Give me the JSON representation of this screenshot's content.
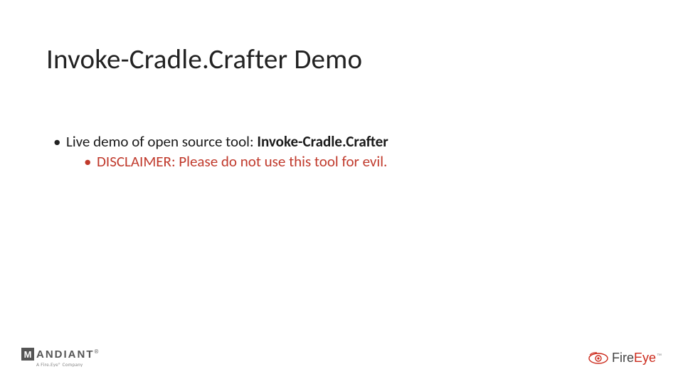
{
  "title": "Invoke-Cradle.Crafter Demo",
  "bullets": {
    "lvl1_prefix": "Live demo of open source tool: ",
    "lvl1_bold": "Invoke-Cradle.Crafter",
    "lvl2": "DISCLAIMER: Please do not use this tool for evil."
  },
  "logos": {
    "mandiant": {
      "m": "M",
      "name": "ANDIANT",
      "reg": "®",
      "sub": "A Fire.Eye® Company"
    },
    "fireeye": {
      "fire": "Fire",
      "eye": "Eye",
      "tm": "™"
    }
  },
  "colors": {
    "accent": "#c0392b",
    "text": "#1a1a1a"
  }
}
